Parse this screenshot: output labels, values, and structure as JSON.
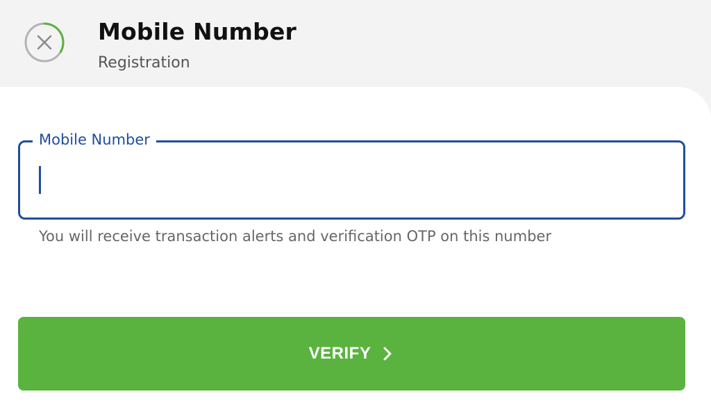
{
  "header": {
    "title": "Mobile Number",
    "subtitle": "Registration",
    "close_icon": "close-circle-icon",
    "progress_color": "#5ab33e"
  },
  "form": {
    "mobile_field": {
      "label": "Mobile Number",
      "value": "",
      "placeholder": ""
    },
    "hint": "You will receive transaction alerts and verification OTP on this number"
  },
  "actions": {
    "verify_label": "VERIFY",
    "verify_icon": "chevron-right-icon"
  },
  "colors": {
    "accent_blue": "#1f4e9c",
    "button_green": "#5ab33e",
    "background": "#f3f3f3"
  }
}
